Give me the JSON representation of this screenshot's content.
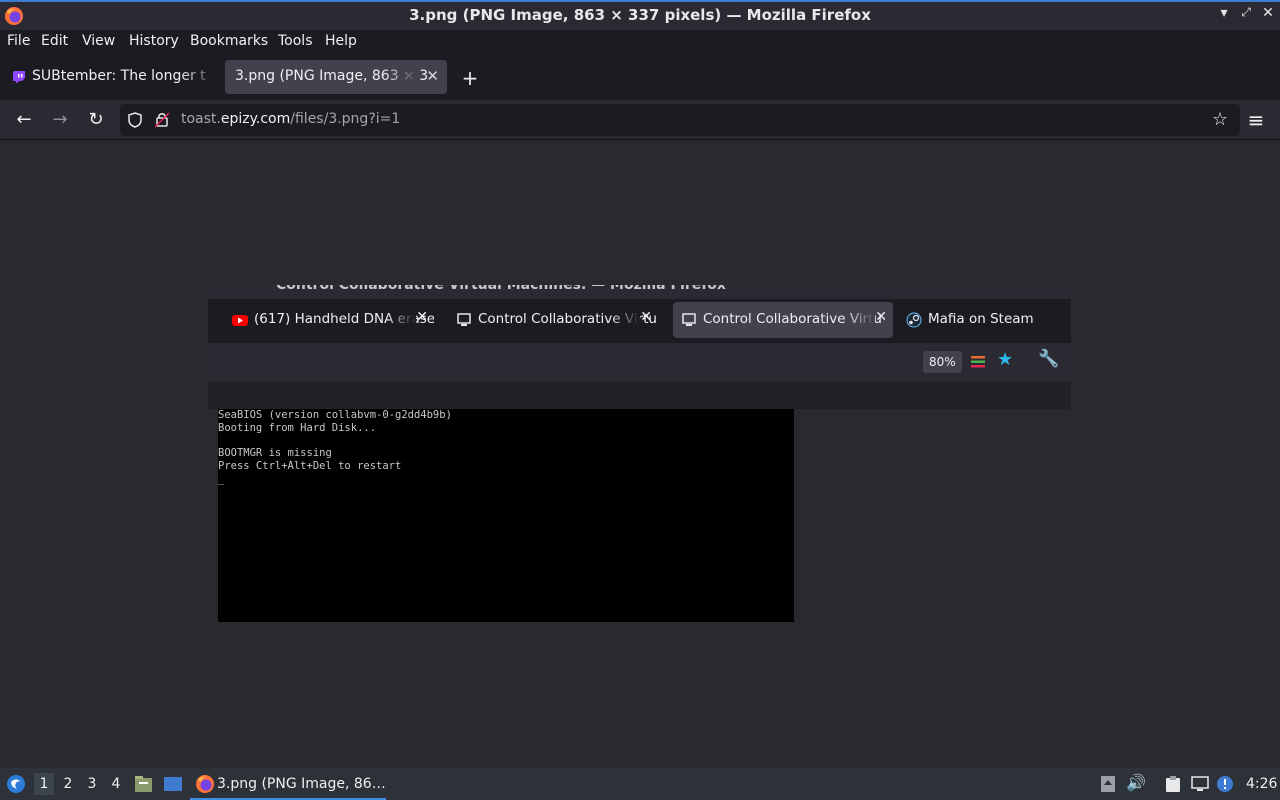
{
  "window": {
    "title": "3.png (PNG Image, 863 × 337 pixels) — Mozilla Firefox"
  },
  "menu": [
    "File",
    "Edit",
    "View",
    "History",
    "Bookmarks",
    "Tools",
    "Help"
  ],
  "tabs": [
    {
      "label": "SUBtember: The longer t",
      "icon": "twitch-icon",
      "active": false
    },
    {
      "label": "3.png (PNG Image, 863 × 3",
      "icon": "none",
      "active": true
    }
  ],
  "urlbar": {
    "prefix": "toast.",
    "domain": "epizy.com",
    "path": "/files/3.png?i=1"
  },
  "image": {
    "window_title": "Control Collaborative Virtual Machines. — Mozilla Firefox",
    "tabs": [
      {
        "label": "(617) Handheld DNA erase",
        "icon": "youtube-icon"
      },
      {
        "label": "Control Collaborative Virtu",
        "icon": "computer-icon"
      },
      {
        "label": "Control Collaborative Virtu",
        "icon": "computer-icon",
        "active": true
      },
      {
        "label": "Mafia on Steam",
        "icon": "steam-icon"
      }
    ],
    "zoom": "80%",
    "terminal_lines": [
      "SeaBIOS (version collabvm-0-g2dd4b9b)",
      "Booting from Hard Disk...",
      "",
      "BOOTMGR is missing",
      "Press Ctrl+Alt+Del to restart",
      "_"
    ]
  },
  "taskbar": {
    "workspaces": [
      "1",
      "2",
      "3",
      "4"
    ],
    "active_workspace": "1",
    "task_label": "3.png (PNG Image, 86…",
    "clock": "4:26"
  },
  "colors": {
    "accent": "#3d7bd1",
    "chrome_dark": "#1c1b22",
    "chrome": "#2b2a33",
    "active_tab": "#42414d"
  }
}
